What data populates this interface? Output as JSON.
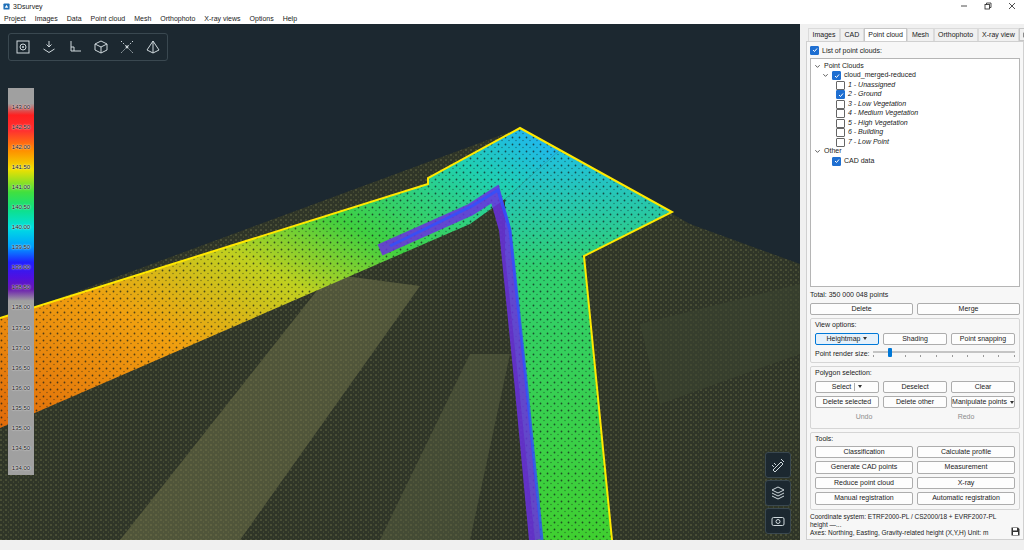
{
  "window": {
    "title": "3Dsurvey"
  },
  "menu": [
    "Project",
    "Images",
    "Data",
    "Point cloud",
    "Mesh",
    "Orthophoto",
    "X-ray views",
    "Options",
    "Help"
  ],
  "legend": {
    "ticks": [
      "143.00",
      "142.50",
      "142.00",
      "141.50",
      "141.00",
      "140.50",
      "140.00",
      "139.50",
      "139.00",
      "138.50",
      "138.00",
      "137.50",
      "137.00",
      "136.50",
      "136.00",
      "135.50",
      "135.00",
      "134.50",
      "134.00"
    ]
  },
  "panel": {
    "tabs": [
      {
        "label": "Images",
        "selected": false
      },
      {
        "label": "CAD",
        "selected": false
      },
      {
        "label": "Point cloud",
        "selected": true
      },
      {
        "label": "Mesh",
        "selected": false
      },
      {
        "label": "Orthophoto",
        "selected": false
      },
      {
        "label": "X-ray view",
        "selected": false
      }
    ],
    "list_toggle": {
      "label": "List of point clouds:",
      "checked": true
    },
    "tree": [
      {
        "label": "Point Clouds",
        "expanded": true,
        "items": [
          {
            "label": "cloud_merged-reduced",
            "checked": true,
            "expanded": true,
            "classes": [
              {
                "label": "1 - Unassigned",
                "checked": false
              },
              {
                "label": "2 - Ground",
                "checked": true
              },
              {
                "label": "3 - Low Vegetation",
                "checked": false
              },
              {
                "label": "4 - Medium Vegetation",
                "checked": false
              },
              {
                "label": "5 - High Vegetation",
                "checked": false
              },
              {
                "label": "6 - Building",
                "checked": false
              },
              {
                "label": "7 - Low Point",
                "checked": false
              }
            ]
          }
        ]
      },
      {
        "label": "Other",
        "expanded": true,
        "items": [
          {
            "label": "CAD data",
            "checked": true
          }
        ]
      }
    ],
    "total": "Total: 350 000 048 points",
    "actions": [
      "Delete",
      "Merge"
    ],
    "view_options": {
      "title": "View options:",
      "buttons": [
        {
          "label": "Heightmap",
          "kind": "dropdown",
          "selected": true
        },
        {
          "label": "Shading",
          "kind": "button",
          "selected": false
        },
        {
          "label": "Point snapping",
          "kind": "button",
          "selected": false
        }
      ],
      "slider": {
        "label": "Point render size:",
        "level": 0.12
      }
    },
    "polygon_selection": {
      "title": "Polygon selection:",
      "rows": [
        [
          {
            "label": "Select",
            "kind": "split",
            "disabled": false
          },
          {
            "label": "Deselect",
            "kind": "button",
            "disabled": false
          },
          {
            "label": "Clear",
            "kind": "button",
            "disabled": false
          }
        ],
        [
          {
            "label": "Delete selected",
            "kind": "button",
            "disabled": false
          },
          {
            "label": "Delete other",
            "kind": "button",
            "disabled": false
          },
          {
            "label": "Manipulate points",
            "kind": "dropdown",
            "disabled": false
          }
        ],
        [
          {
            "label": "Undo",
            "kind": "flat",
            "disabled": true
          },
          {
            "label": "Redo",
            "kind": "flat",
            "disabled": true
          }
        ]
      ]
    },
    "tools": {
      "title": "Tools:",
      "buttons": [
        "Classification",
        "Calculate profile",
        "Generate CAD points",
        "Measurement",
        "Reduce point cloud",
        "X-ray",
        "Manual registration",
        "Automatic registration"
      ]
    }
  },
  "status_bar": [
    "Coordinate system: ETRF2000-PL / CS2000/18 + EVRF2007-PL height —...",
    "Axes: Northing, Easting, Gravity-related height (X,Y,H) Unit: m"
  ]
}
